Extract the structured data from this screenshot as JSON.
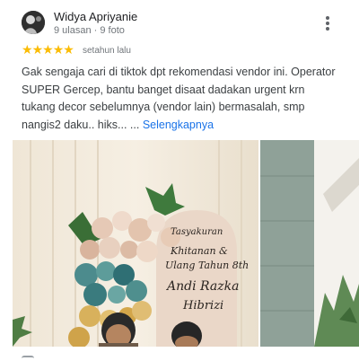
{
  "review": {
    "author": {
      "name": "Widya Apriyanie",
      "meta": "9 ulasan · 9 foto",
      "avatar_icon": "user-avatar"
    },
    "more_icon": "more-vert-icon",
    "rating": {
      "value": 5,
      "max": 5,
      "star_color": "#fbbc04"
    },
    "time": "setahun lalu",
    "text": "Gak sengaja cari di tiktok dpt rekomendasi vendor ini. Operator SUPER Gercep, bantu banget disaat dadakan urgent krn tukang decor sebelumnya (vendor lain) bermasalah, smp nangis2 daku.. hiks... ...",
    "read_more": "Selengkapnya",
    "link_color": "#1a73e8",
    "photos": {
      "main": {
        "sign_lines": [
          "Tasyakuran",
          "Khitanan &",
          "Ulang Tahun 8th",
          "Andi Razka",
          "Hibrizi"
        ]
      }
    }
  }
}
